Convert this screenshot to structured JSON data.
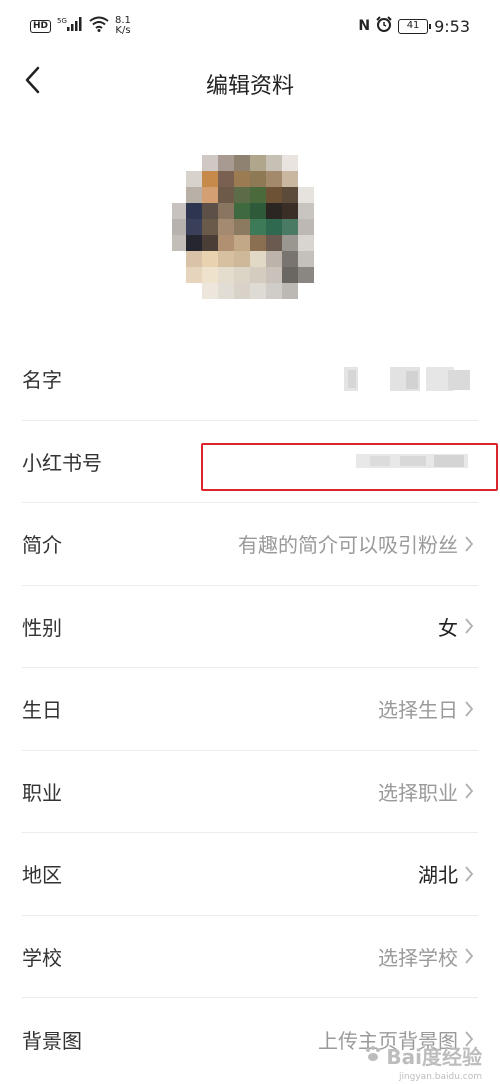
{
  "status_bar": {
    "hd": "HD",
    "signal": "5G",
    "speed_value": "8.1",
    "speed_unit": "K/s",
    "nfc": "N",
    "battery": "41",
    "time": "9:53"
  },
  "nav": {
    "title": "编辑资料"
  },
  "profile_rows": [
    {
      "label": "名字",
      "value": "",
      "has_chevron": false
    },
    {
      "label": "小红书号",
      "value": "",
      "has_chevron": false
    },
    {
      "label": "简介",
      "value": "有趣的简介可以吸引粉丝",
      "has_chevron": true
    },
    {
      "label": "性别",
      "value": "女",
      "has_chevron": true
    },
    {
      "label": "生日",
      "value": "选择生日",
      "has_chevron": true
    },
    {
      "label": "职业",
      "value": "选择职业",
      "has_chevron": true
    },
    {
      "label": "地区",
      "value": "湖北",
      "has_chevron": true
    },
    {
      "label": "学校",
      "value": "选择学校",
      "has_chevron": true
    },
    {
      "label": "背景图",
      "value": "上传主页背景图",
      "has_chevron": true
    }
  ],
  "watermark": {
    "text": "Bai度经验",
    "sub": "jingyan.baidu.com"
  },
  "colors": {
    "highlight": "#d9252b",
    "placeholder_text": "#9a9a9a",
    "value_text": "#222222"
  }
}
